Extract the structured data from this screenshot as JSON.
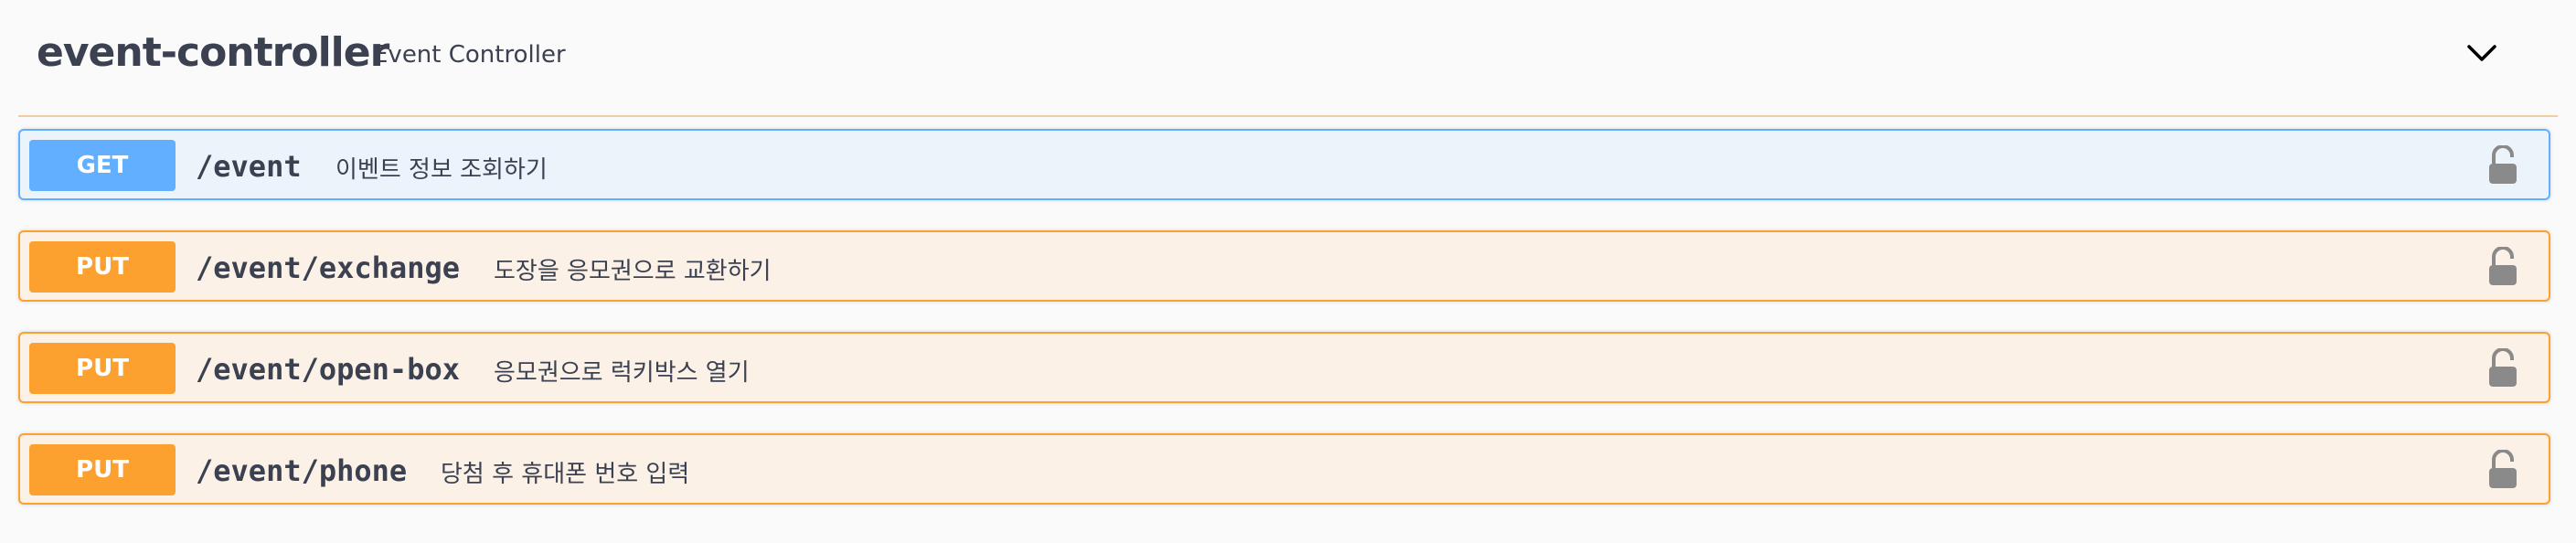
{
  "tag": {
    "name": "event-controller",
    "description": "Event Controller"
  },
  "operations": [
    {
      "method": "GET",
      "path": "/event",
      "summary": "이벤트 정보 조회하기"
    },
    {
      "method": "PUT",
      "path": "/event/exchange",
      "summary": "도장을 응모권으로 교환하기"
    },
    {
      "method": "PUT",
      "path": "/event/open-box",
      "summary": "응모권으로 럭키박스 열기"
    },
    {
      "method": "PUT",
      "path": "/event/phone",
      "summary": "당첨 후 휴대폰 번호 입력"
    }
  ],
  "colors": {
    "get": "#61affe",
    "put": "#fca130",
    "text": "#3b4151"
  },
  "icons": {
    "collapse": "chevron-up-icon",
    "lock": "unlocked-lock-icon"
  }
}
